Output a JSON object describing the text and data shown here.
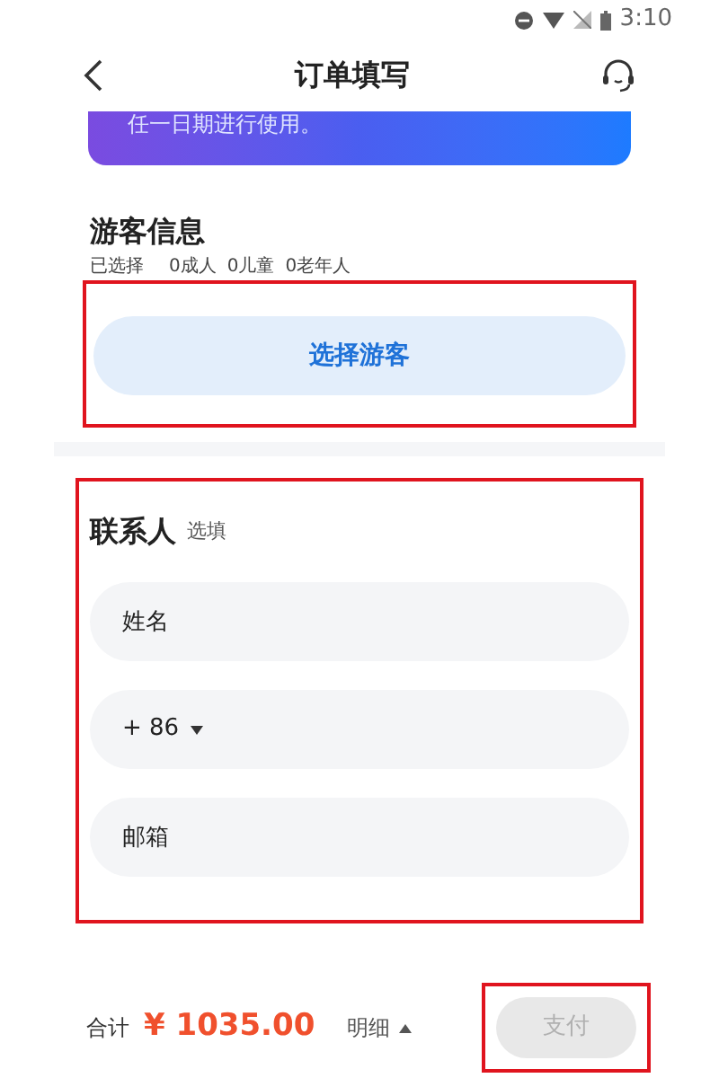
{
  "status_bar": {
    "time": "3:10"
  },
  "header": {
    "title": "订单填写"
  },
  "banner": {
    "text": "任一日期进行使用。"
  },
  "visitors": {
    "title": "游客信息",
    "highlighted": true,
    "counts": [
      "已选择",
      "0成人",
      "0儿童",
      "0老年人"
    ],
    "button": "选择游客"
  },
  "contact": {
    "title": "联系人",
    "tag": "选填",
    "highlighted": true,
    "fields": [
      {
        "kind": "text",
        "placeholder": "姓名"
      },
      {
        "kind": "phone",
        "value": "+ 86"
      },
      {
        "kind": "text",
        "placeholder": "邮箱"
      }
    ]
  },
  "footer": {
    "total_label": "合计",
    "amount": "¥ 1035.00",
    "details": "明细",
    "pay": {
      "label": "支付",
      "disabled": true,
      "highlighted": true
    }
  }
}
